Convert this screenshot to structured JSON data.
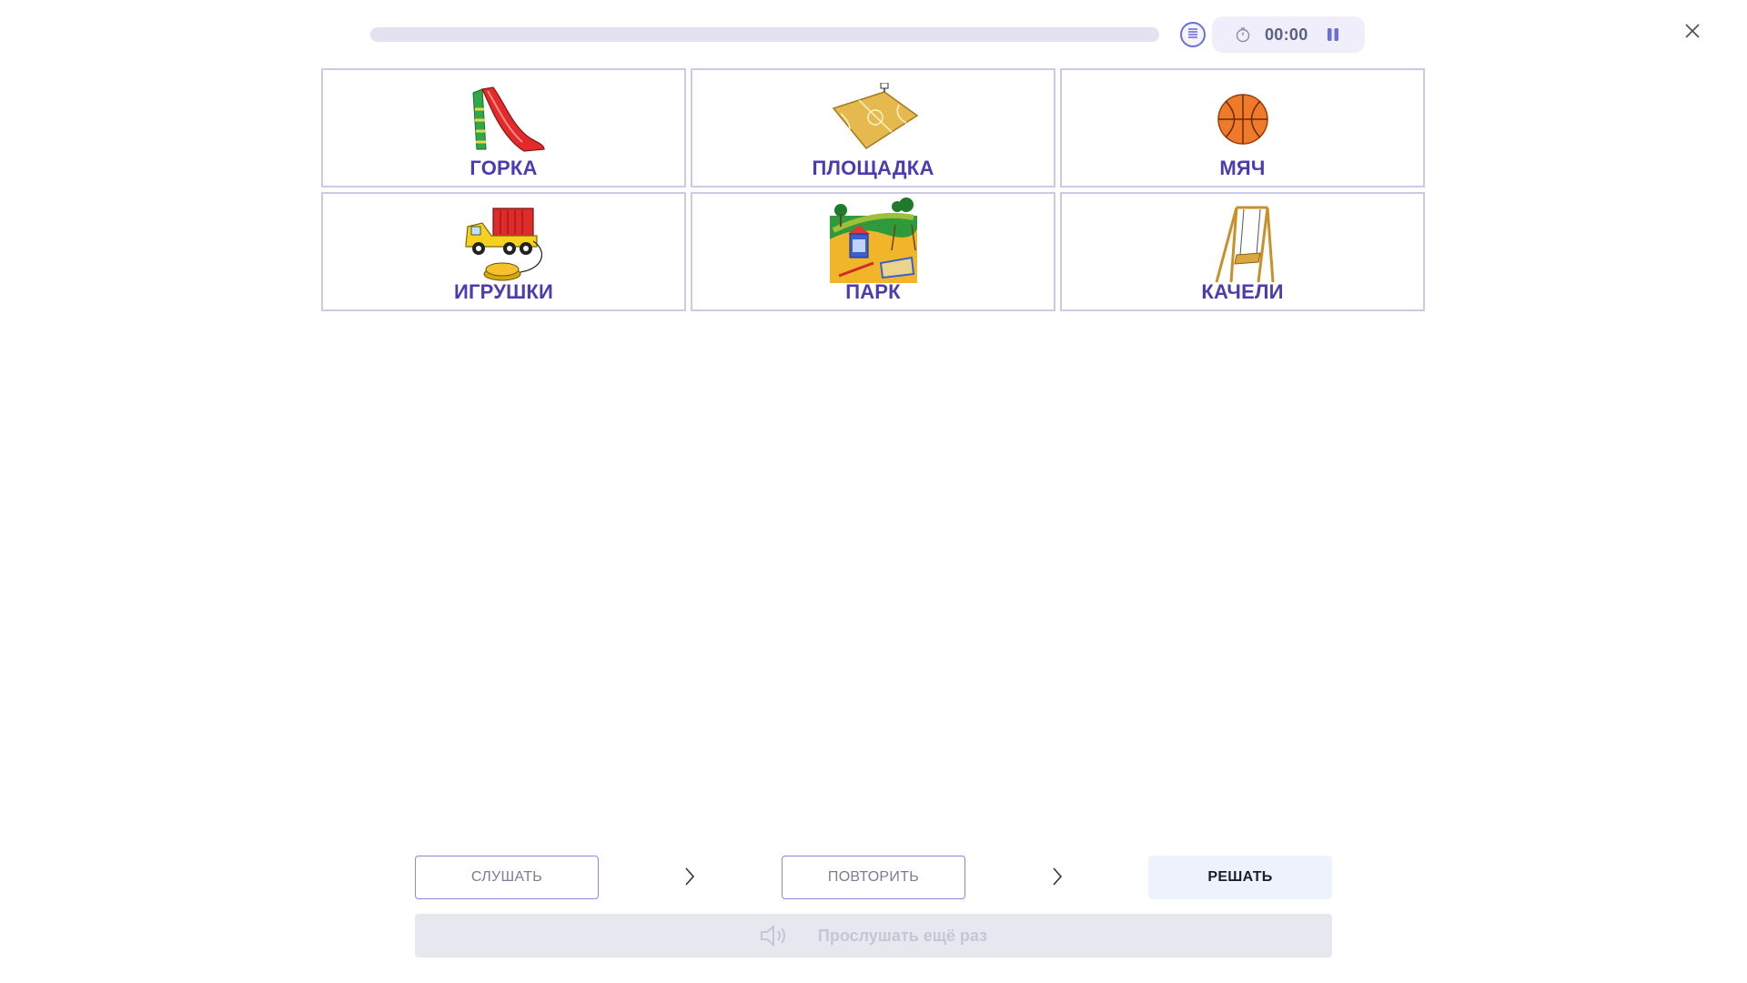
{
  "header": {
    "timer": "00:00",
    "icons": {
      "list": "list-icon",
      "clock": "stopwatch-icon",
      "pause": "pause-icon",
      "close": "close-icon"
    }
  },
  "cards": [
    {
      "label": "ГОРКА",
      "icon": "slide-icon"
    },
    {
      "label": "ПЛОЩАДКА",
      "icon": "court-icon"
    },
    {
      "label": "МЯЧ",
      "icon": "ball-icon"
    },
    {
      "label": "ИГРУШКИ",
      "icon": "toy-truck-icon"
    },
    {
      "label": "ПАРК",
      "icon": "park-icon"
    },
    {
      "label": "КАЧЕЛИ",
      "icon": "swing-icon"
    }
  ],
  "steps": {
    "listen": "СЛУШАТЬ",
    "repeat": "ПОВТОРИТЬ",
    "solve": "РЕШАТЬ"
  },
  "replay": {
    "label": "Прослушать ещё раз",
    "icon": "speaker-icon"
  },
  "colors": {
    "accent": "#4d3bb0",
    "border": "#c9cbe7",
    "progress_track": "#e4e2f1"
  }
}
